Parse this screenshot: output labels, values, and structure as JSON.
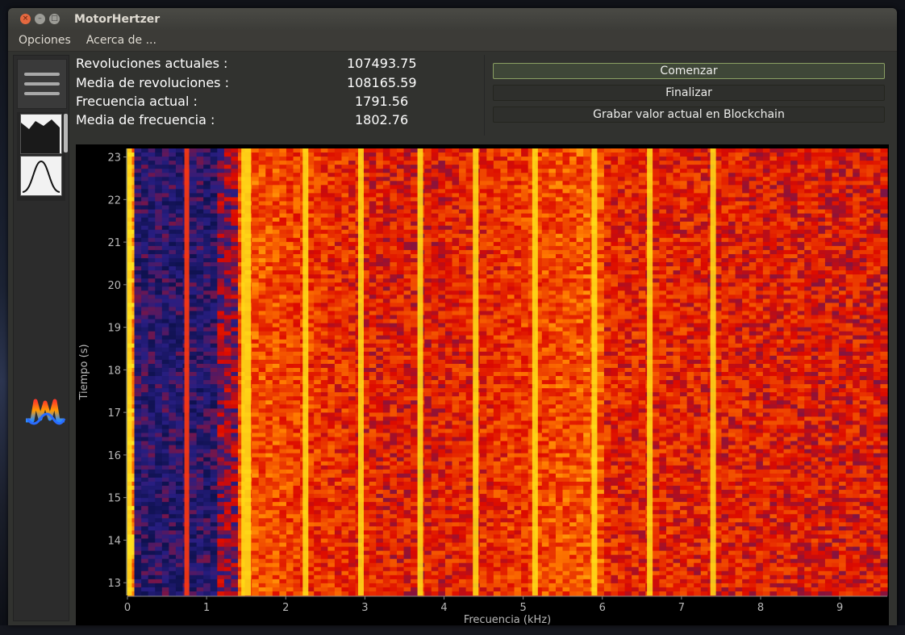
{
  "app": {
    "title": "MotorHertzer"
  },
  "menu": [
    {
      "label": "Opciones"
    },
    {
      "label": "Acerca de ..."
    }
  ],
  "stats": [
    {
      "label": "Revoluciones actuales :",
      "value": "107493.75"
    },
    {
      "label": "Media de revoluciones :",
      "value": "108165.59"
    },
    {
      "label": "Frecuencia actual :",
      "value": "1791.56"
    },
    {
      "label": "Media de frecuencia :",
      "value": "1802.76"
    }
  ],
  "buttons": {
    "start": "Comenzar",
    "finish": "Finalizar",
    "record": "Grabar valor actual en Blockchain"
  },
  "icons": {
    "menu": "hamburger-icon",
    "spectrum_tool": "area-chart-icon",
    "distribution_tool": "bell-curve-icon",
    "app_logo": "motorhertzer-logo-icon"
  },
  "chart_data": {
    "type": "heatmap",
    "xlabel": "Frecuencia (kHz)",
    "ylabel": "Tiempo (s)",
    "xlim": [
      0,
      9.6
    ],
    "ylim": [
      12.7,
      23.2
    ],
    "xticks": [
      0,
      1,
      2,
      3,
      4,
      5,
      6,
      7,
      8,
      9
    ],
    "yticks": [
      13,
      14,
      15,
      16,
      17,
      18,
      19,
      20,
      21,
      22,
      23
    ],
    "colormap": "blue-red-yellow",
    "peak_frequencies_khz": [
      0.02,
      0.75,
      1.5,
      2.25,
      2.95,
      3.7,
      4.4,
      5.15,
      5.9,
      6.6,
      7.4
    ],
    "grid": false
  }
}
